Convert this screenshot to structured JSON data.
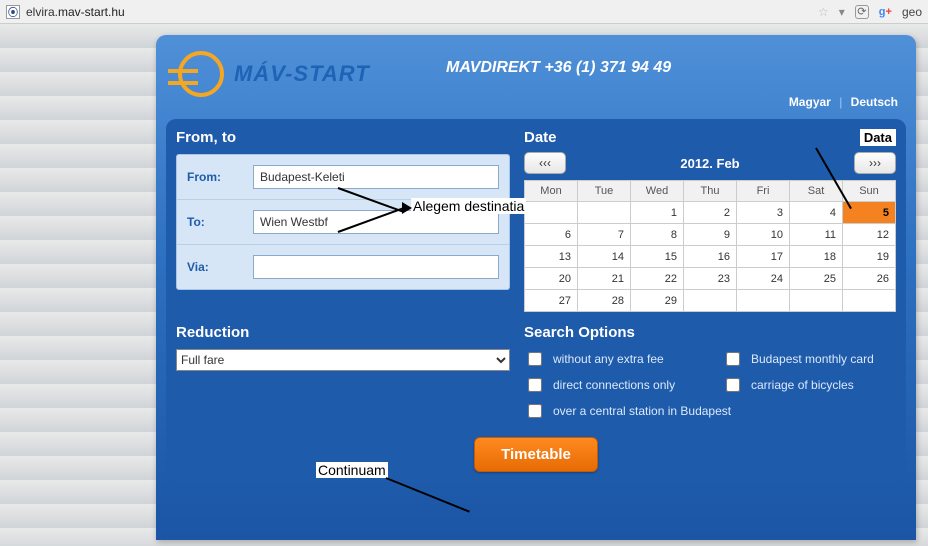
{
  "browser": {
    "url_sub": "elvira.",
    "url_host": "mav-start.hu",
    "right_text": "geo"
  },
  "header": {
    "brand": "MÁV-START",
    "phone": "MAVDIREKT +36 (1) 371 94 49",
    "lang1": "Magyar",
    "lang2": "Deutsch"
  },
  "fromto": {
    "title": "From, to",
    "from_label": "From:",
    "to_label": "To:",
    "via_label": "Via:",
    "from_value": "Budapest-Keleti",
    "to_value": "Wien Westbf",
    "via_value": ""
  },
  "date": {
    "title": "Date",
    "badge": "Data",
    "prev": "‹‹‹",
    "next": "›››",
    "month": "2012. Feb",
    "dow": [
      "Mon",
      "Tue",
      "Wed",
      "Thu",
      "Fri",
      "Sat",
      "Sun"
    ],
    "grid": [
      [
        "",
        "",
        "1",
        "2",
        "3",
        "4",
        "5"
      ],
      [
        "6",
        "7",
        "8",
        "9",
        "10",
        "11",
        "12"
      ],
      [
        "13",
        "14",
        "15",
        "16",
        "17",
        "18",
        "19"
      ],
      [
        "20",
        "21",
        "22",
        "23",
        "24",
        "25",
        "26"
      ],
      [
        "27",
        "28",
        "29",
        "",
        "",
        "",
        ""
      ]
    ],
    "selected": "5"
  },
  "reduction": {
    "title": "Reduction",
    "value": "Full fare"
  },
  "options": {
    "title": "Search Options",
    "o1": "without any extra fee",
    "o2": "Budapest monthly card",
    "o3": "direct connections only",
    "o4": "carriage of bicycles",
    "o5": "over a central station in Budapest"
  },
  "buttons": {
    "timetable": "Timetable"
  },
  "annot": {
    "dest": "Alegem destinatia",
    "cont": "Continuam"
  }
}
